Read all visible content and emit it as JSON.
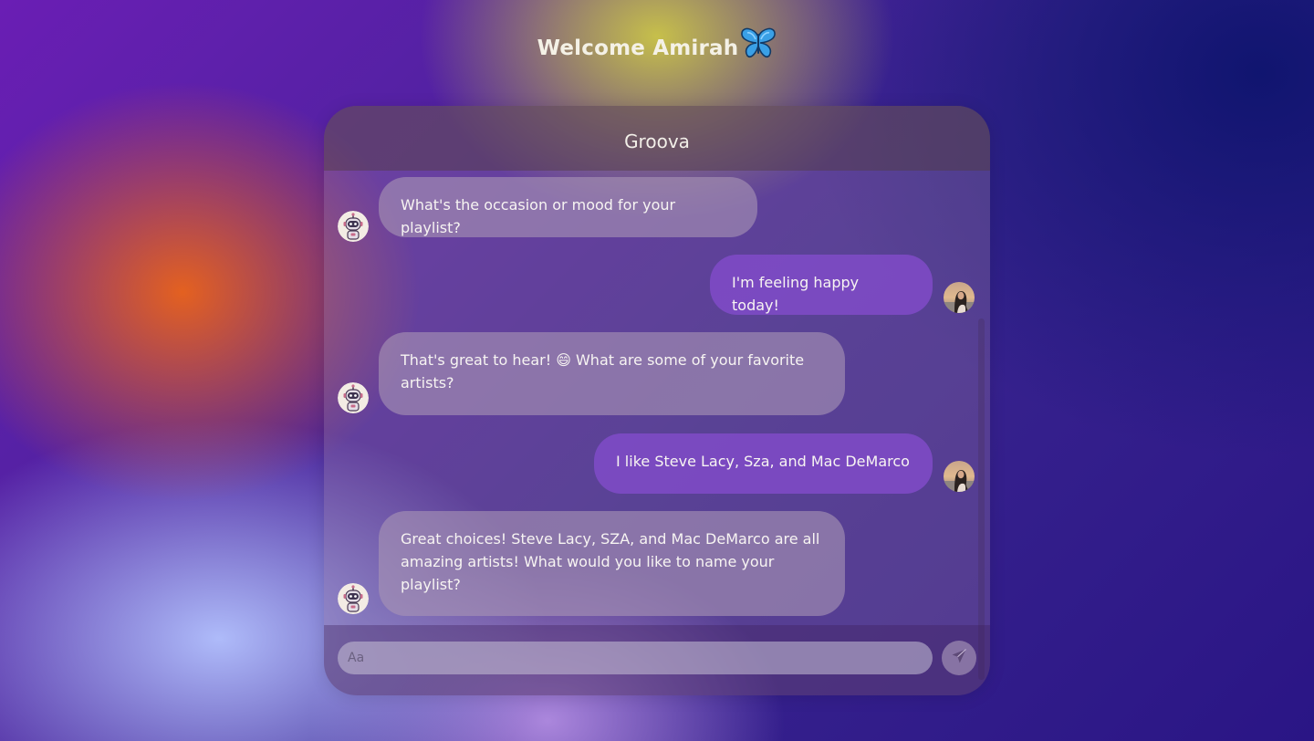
{
  "welcome": {
    "title": "Welcome Amirah",
    "icon": "butterfly-icon"
  },
  "chat": {
    "title": "Groova",
    "messages": [
      {
        "sender": "bot",
        "text": "What's the occasion or mood for your playlist?",
        "avatar": "robot-avatar"
      },
      {
        "sender": "user",
        "text": "I'm feeling happy today!",
        "avatar": "user-photo-avatar"
      },
      {
        "sender": "bot",
        "text": "That's great to hear! 😄 What are some of your favorite artists?",
        "avatar": "robot-avatar"
      },
      {
        "sender": "user",
        "text": "I like Steve Lacy, Sza, and Mac DeMarco",
        "avatar": "user-photo-avatar"
      },
      {
        "sender": "bot",
        "text": "Great choices! Steve Lacy, SZA, and Mac DeMarco are all amazing artists! What would you like to name your playlist?",
        "avatar": "robot-avatar"
      }
    ]
  },
  "composer": {
    "placeholder": "Aa",
    "value": "",
    "send_icon": "paper-plane-icon"
  },
  "colors": {
    "user_bubble": "#804bc8",
    "bot_bubble": "#a894b4",
    "text": "#f7f4f2"
  }
}
